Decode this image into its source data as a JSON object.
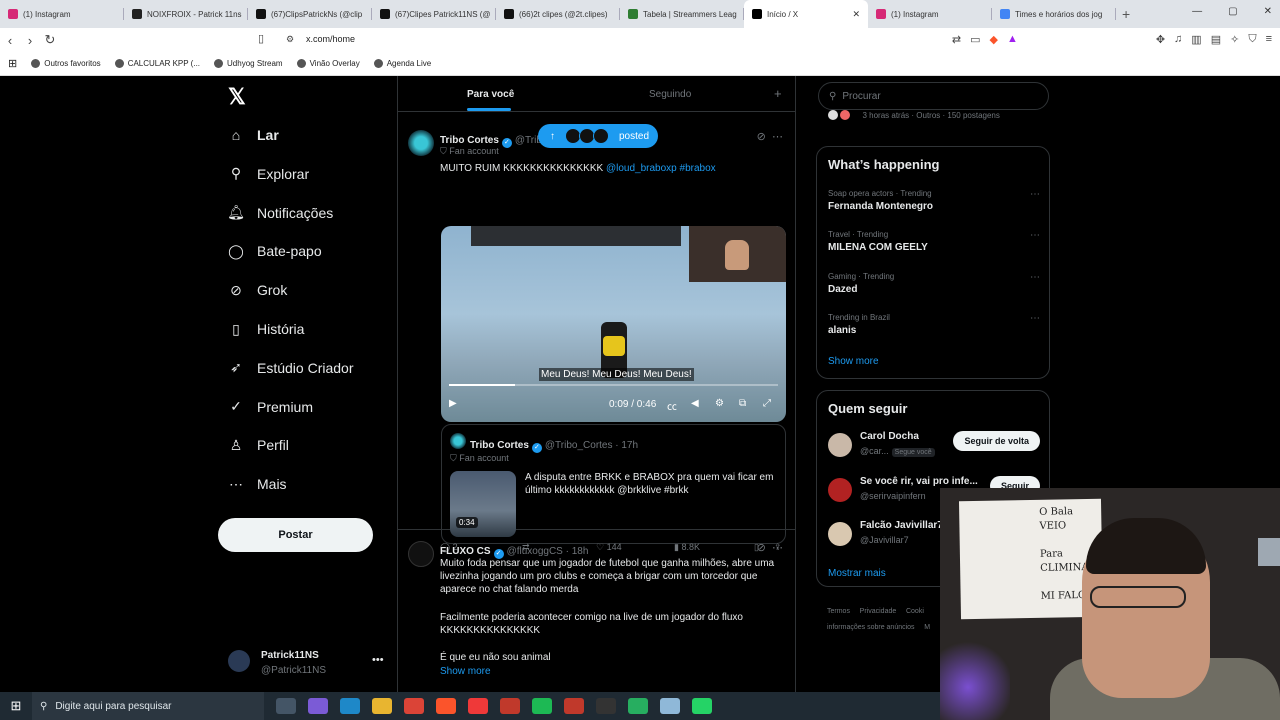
{
  "browser": {
    "tabs": [
      {
        "title": "(1) Instagram",
        "icon": "instagram-icon",
        "color": "#d62976"
      },
      {
        "title": "NOIXFROIX - Patrick 11ns",
        "icon": "notion-icon",
        "color": "#222222"
      },
      {
        "title": "(67)ClipsPatrickNs (@clip",
        "icon": "tiktok-icon",
        "color": "#111111"
      },
      {
        "title": "(67)Clipes Patrick11NS (@",
        "icon": "tiktok-icon",
        "color": "#111111"
      },
      {
        "title": "(66)2t clipes (@2t.clipes)",
        "icon": "tiktok-icon",
        "color": "#111111"
      },
      {
        "title": "Tabela | Streammers Leag",
        "icon": "sheet-icon",
        "color": "#2e7d32"
      },
      {
        "title": "Início / X",
        "icon": "x-icon",
        "color": "#000000",
        "active": true
      },
      {
        "title": "(1) Instagram",
        "icon": "instagram-icon",
        "color": "#d62976"
      },
      {
        "title": "Times e horários dos jog",
        "icon": "google-icon",
        "color": "#4285f4"
      }
    ],
    "close_glyph": "✕",
    "url": "x.com/home",
    "bookmarks": [
      "Outros favoritos",
      "CALCULAR KPP (...",
      "Udhyog Stream",
      "Vinão Overlay",
      "Agenda Live"
    ]
  },
  "x": {
    "logo": "𝕏",
    "nav": [
      {
        "label": "Lar",
        "icon": "home-icon",
        "glyph": "⌂"
      },
      {
        "label": "Explorar",
        "icon": "search-icon",
        "glyph": "⚲"
      },
      {
        "label": "Notificações",
        "icon": "bell-icon",
        "glyph": "🔔︎"
      },
      {
        "label": "Bate-papo",
        "icon": "chat-icon",
        "glyph": "◯"
      },
      {
        "label": "Grok",
        "icon": "grok-icon",
        "glyph": "⊘"
      },
      {
        "label": "História",
        "icon": "bookmark-icon",
        "glyph": "▯"
      },
      {
        "label": "Estúdio Criador",
        "icon": "rocket-icon",
        "glyph": "➶"
      },
      {
        "label": "Premium",
        "icon": "verified-icon",
        "glyph": "✓"
      },
      {
        "label": "Perfil",
        "icon": "person-icon",
        "glyph": "♙"
      },
      {
        "label": "Mais",
        "icon": "more-icon",
        "glyph": "⋯"
      }
    ],
    "post_button": "Postar",
    "profile": {
      "name": "Patrick11NS",
      "handle": "@Patrick11NS"
    },
    "feed_tabs": {
      "for_you": "Para você",
      "following": "Seguindo"
    },
    "posted_pill": "posted",
    "tweets": [
      {
        "name": "Tribo Cortes",
        "handle": "@Trib",
        "badge": "Fan account",
        "text": "MUITO RUIM KKKKKKKKKKKKKKK",
        "mention": "@loud_braboxp",
        "hashtag": "#brabox",
        "video": {
          "subtitle": "Meu Deus! Meu Deus! Meu Deus!",
          "time": "0:09 / 0:46",
          "progress": 0.2
        },
        "quote": {
          "name": "Tribo Cortes",
          "handle": "@Tribo_Cortes · 17h",
          "badge": "Fan account",
          "text": "A disputa entre BRKK e BRABOX pra quem vai ficar em último kkkkkkkkkkkk @brkklive #brkk",
          "duration": "0:34"
        },
        "actions": {
          "replies": "2",
          "reposts": "",
          "likes": "144",
          "views": "8.8K"
        }
      },
      {
        "name": "FLUXO CS",
        "handle": "@fluxoggCS · 18h",
        "text1": "Muito foda pensar que um jogador de futebol que ganha milhões, abre uma livezinha jogando um pro clubs e começa a brigar com um torcedor que aparece no chat falando merda",
        "text2": "Facilmente poderia acontecer comigo na live de um jogador do fluxo KKKKKKKKKKKKKKK",
        "text3": "É que eu não sou animal",
        "show_more": "Show more"
      }
    ]
  },
  "sidebar": {
    "search_placeholder": "Procurar",
    "top_meta": "3 horas atrás · Outros · 150 postagens",
    "happening_title": "What’s happening",
    "trends": [
      {
        "meta": "Soap opera actors · Trending",
        "name": "Fernanda Montenegro"
      },
      {
        "meta": "Travel · Trending",
        "name": "MILENA COM GEELY"
      },
      {
        "meta": "Gaming · Trending",
        "name": "Dazed"
      },
      {
        "meta": "Trending in Brazil",
        "name": "alanis"
      }
    ],
    "show_more": "Show more",
    "who_to_follow_title": "Quem seguir",
    "who_to_follow": [
      {
        "name": "Carol Docha",
        "handle": "@car...",
        "follows_you": "Segue você",
        "button": "Seguir de volta"
      },
      {
        "name": "Se você rir, vai pro infe...",
        "handle": "@serirvaipinfern",
        "button": "Seguir"
      },
      {
        "name": "Falcão Javivillar7",
        "handle": "@Javivillar7",
        "button": ""
      }
    ],
    "show_more_pt": "Mostrar mais",
    "footer": "Termos     Privacidade     Cooki\ninformações sobre anúncios     M"
  },
  "webcam": {
    "card_text": "O Bala\nVEIO\n\nPara\nCLIMINAR\n\nMI FALO"
  },
  "taskbar": {
    "search_placeholder": "Digite aqui para pesquisar",
    "apps": [
      {
        "icon": "task-view-icon",
        "color": "#445566"
      },
      {
        "icon": "copilot-icon",
        "color": "#7b5bd6"
      },
      {
        "icon": "edge-icon",
        "color": "#1e88c8"
      },
      {
        "icon": "explorer-icon",
        "color": "#e8b530"
      },
      {
        "icon": "chrome-icon",
        "color": "#db4437"
      },
      {
        "icon": "brave-icon",
        "color": "#fb542b"
      },
      {
        "icon": "vivaldi-icon",
        "color": "#ef3939"
      },
      {
        "icon": "app-icon",
        "color": "#c0392b"
      },
      {
        "icon": "spotify-icon",
        "color": "#1db954"
      },
      {
        "icon": "obs-icon",
        "color": "#c0392b"
      },
      {
        "icon": "steam-icon",
        "color": "#333333"
      },
      {
        "icon": "game-icon",
        "color": "#27ae60"
      },
      {
        "icon": "notepad-icon",
        "color": "#8fb8d8"
      },
      {
        "icon": "whatsapp-icon",
        "color": "#25d366"
      }
    ]
  }
}
